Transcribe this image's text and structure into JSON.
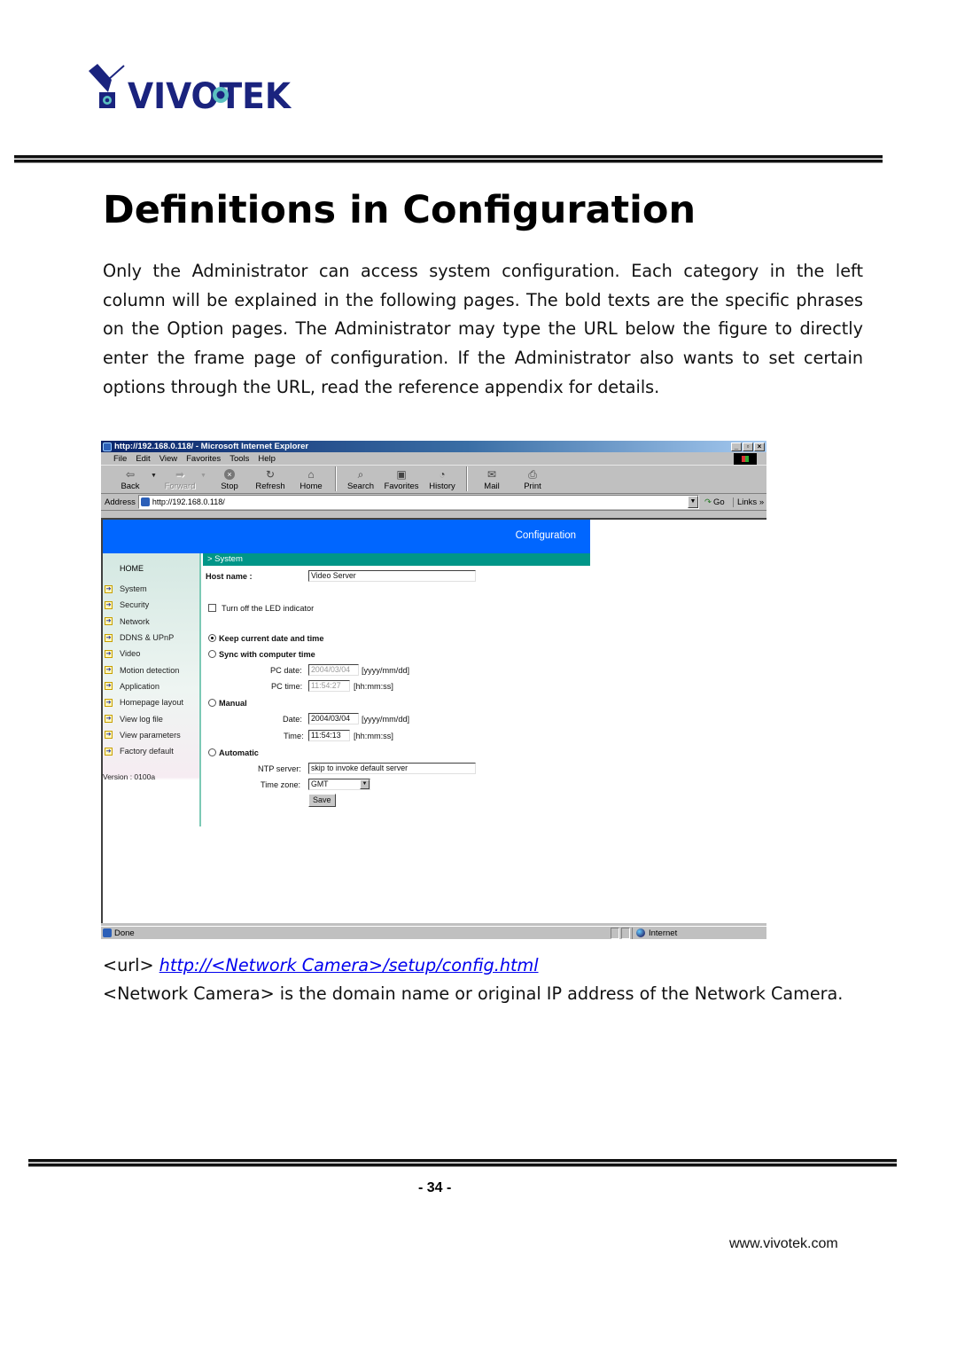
{
  "brand": {
    "logo_text": "VIVOTEK",
    "logo_color": "#1a237e",
    "logo_accent": "#5bc0c0"
  },
  "page_title": "Definitions in Configuration",
  "intro_paragraph": "Only the Administrator can access system configuration. Each category in the left column will be explained in the following pages. The bold texts are the specific phrases on the Option pages. The Administrator may type the URL below the figure to directly enter the frame page of configuration. If the Administrator also wants to set certain options through the URL, read the reference appendix for details.",
  "browser": {
    "window_title": "http://192.168.0.118/ - Microsoft Internet Explorer",
    "window_buttons": [
      "minimize",
      "restore",
      "close"
    ],
    "menu": [
      "File",
      "Edit",
      "View",
      "Favorites",
      "Tools",
      "Help"
    ],
    "toolbar": {
      "back": "Back",
      "forward": "Forward",
      "stop": "Stop",
      "refresh": "Refresh",
      "home": "Home",
      "search": "Search",
      "favorites": "Favorites",
      "history": "History",
      "mail": "Mail",
      "print": "Print"
    },
    "address_label": "Address",
    "address_value": "http://192.168.0.118/",
    "go_label": "Go",
    "links_label": "Links »",
    "status": {
      "left": "Done",
      "zone": "Internet"
    }
  },
  "config_page": {
    "header_title": "Configuration",
    "header_color": "#0066ff",
    "section_color": "#009688",
    "nav_home": "HOME",
    "nav_items": [
      "System",
      "Security",
      "Network",
      "DDNS & UPnP",
      "Video",
      "Motion detection",
      "Application",
      "Homepage layout",
      "View log file",
      "View parameters",
      "Factory default"
    ],
    "version": "Version : 0100a",
    "section_title": "> System",
    "form": {
      "host_name_label": "Host name :",
      "host_name_value": "Video Server",
      "led_checkbox_label": "Turn off the LED indicator",
      "led_checked": false,
      "radio_keep": "Keep current date and time",
      "radio_sync": "Sync with computer time",
      "pc_date_label": "PC date:",
      "pc_date_value": "2004/03/04",
      "date_format": "[yyyy/mm/dd]",
      "pc_time_label": "PC time:",
      "pc_time_value": "11:54:27",
      "time_format": "[hh:mm:ss]",
      "radio_manual": "Manual",
      "date_label": "Date:",
      "date_value": "2004/03/04",
      "time_label": "Time:",
      "time_value": "11:54:13",
      "radio_automatic": "Automatic",
      "ntp_label": "NTP server:",
      "ntp_value": "skip to invoke default server",
      "timezone_label": "Time zone:",
      "timezone_value": "GMT",
      "save_label": "Save",
      "selected_radio": "Keep current date and time"
    }
  },
  "url_prefix": "<url>",
  "url_link": "http://<Network Camera>/setup/config.html",
  "description": "<Network Camera> is the domain name or original IP address of the Network Camera.",
  "page_number": "- 34 -",
  "site_url": "www.vivotek.com"
}
